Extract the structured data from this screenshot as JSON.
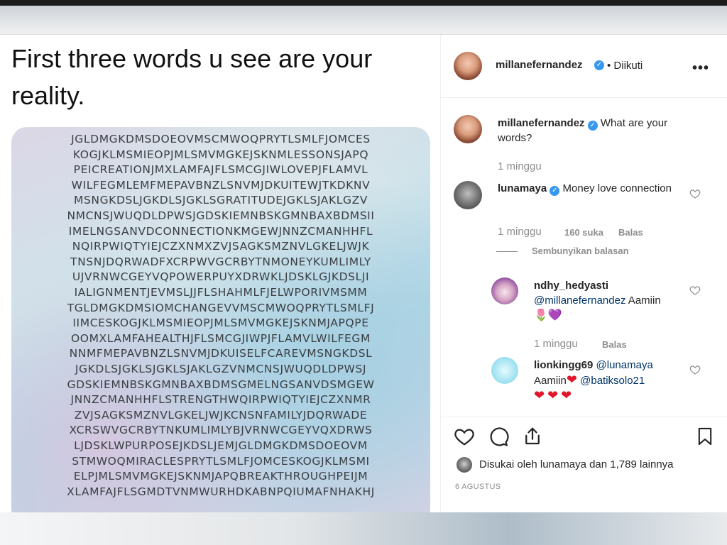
{
  "post": {
    "headline": "First three words u see are your reality.",
    "grid_lines": [
      "JGLDMGKDMSDOEOVMSCMWOQPRYTLSMLFJOMCES",
      "KOGJKLMSMIEOPJMLSMVMGKEJSKNMLESSONSJAPQ",
      "PEICREATIONJMXLAMFAJFLSMCGJIWLOVEPJFLAMVL",
      "WILFEGMLEMFMEPAVBNZLSNVMJDKUITEWJTKDKNV",
      "MSNGKDSLJGKDLSJGKLSGRATITUDEJGKLSJAKLGZV",
      "NMCNSJWUQDLDPWSJGDSKIEMNBSKGMNBAXBDMSII",
      "IMELNGSANVDCONNECTIONKMGEWJNNZCMANHHFL",
      "NQIRPWIQTYIEJCZXNMXZVJSAGKSMZNVLGKELJWJK",
      "TNSNJDQRWADFXCRPWVGCRBYTNMONEYKUMLIMLY",
      "UJVRNWCGEYVQPOWERPUYXDRWKLJDSKLGJKDSLJI",
      "IALIGNMENTJEVMSLJJFLSHAHMLFJELWPORIVMSMM",
      "TGLDMGKDMSIOMCHANGEVVMSCMWOQPRYTLSMLFJ",
      "IIMCESKOGJKLMSMIEOPJMLSMVMGKEJSKNMJAPQPE",
      "OOMXLAMFAHEALTHJFLSMCGJIWPJFLAMVLWILFEGM",
      "NNMFMEPAVBNZLSNVMJDKUISELFCAREVMSNGKDSL",
      "JGKDLSJGKLSJGKLSJAKLGZVNMCNSJWUQDLDPWSJ",
      "GDSKIEMNBSKGMNBAXBDMSGMELNGSANVDSMGEW",
      "JNNZCMANHHFLSTRENGTHWQIRPWIQTYIEJCZXNMR",
      "ZVJSAGKSMZNVLGKELJWJKCNSNFAMILYJDQRWADE",
      "XCRSWVGCRBYTNKUMLIMLYBJVRNWCGEYVQXDRWS",
      "LJDSKLWPURPOSEJKDSLJEMJGLDMGKDMSDOEOVM",
      "STMWOQMIRACLESPRYTLSMLFJOMCESKOGJKLMSMI",
      "ELPJMLSMVMGKEJSKNMJAPQBREAKTHROUGHPEIJM",
      "XLAMFAJFLSGMDTVNMWURHDKABNPQIUMAFNHAKHJ"
    ]
  },
  "header": {
    "username": "millanefernandez",
    "follow_status": "• Diikuti",
    "more": "•••"
  },
  "caption": {
    "username": "millanefernandez",
    "text": "What are your words?",
    "time": "1 minggu"
  },
  "comments": [
    {
      "username": "lunamaya",
      "text": "Money love connection",
      "time": "1 minggu",
      "likes": "160 suka",
      "reply": "Balas",
      "hide_replies": "Sembunyikan balasan"
    }
  ],
  "replies": [
    {
      "username": "ndhy_hedyasti",
      "mention": "@millanefernandez",
      "text": " Aamiin",
      "emojis": "🌷💜",
      "time": "1 minggu",
      "reply": "Balas"
    },
    {
      "username": "lionkingg69",
      "mention": "@lunamaya",
      "text_before": "Aamiin",
      "mention2": "@batiksolo21",
      "hearts": "❤❤❤"
    }
  ],
  "footer": {
    "liked_by": "Disukai oleh lunamaya dan 1,789 lainnya",
    "date": "6 AGUSTUS"
  },
  "colors": {
    "verified": "#3897f0",
    "link": "#003569",
    "muted": "#8e8e8e",
    "heart": "#e0172b"
  }
}
